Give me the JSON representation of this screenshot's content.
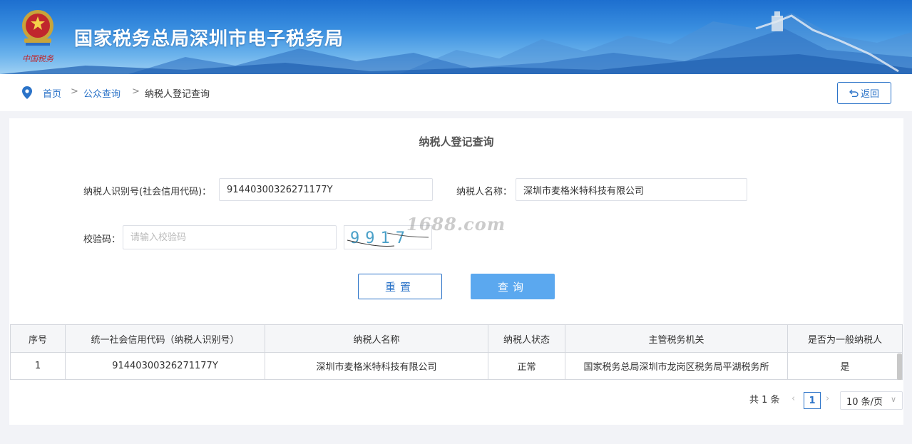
{
  "header": {
    "site_title": "国家税务总局深圳市电子税务局",
    "emblem_caption": "中国税务",
    "colors": {
      "sky_top": "#1d6fcf",
      "sky_bottom": "#9fd0f3",
      "accent": "#2b73c8",
      "primary_button": "#5ba8ef"
    }
  },
  "breadcrumb": {
    "icon": "location-pin-icon",
    "items": [
      "首页",
      "公众查询",
      "纳税人登记查询"
    ],
    "separator": ">",
    "back_label": "返回",
    "back_icon": "undo-icon"
  },
  "form": {
    "title": "纳税人登记查询",
    "taxpayer_id_label": "纳税人识别号(社会信用代码)：",
    "taxpayer_id_value": "91440300326271177Y",
    "taxpayer_name_label": "纳税人名称：",
    "taxpayer_name_value": "深圳市麦格米特科技有限公司",
    "captcha_label": "校验码：",
    "captcha_placeholder": "请输入校验码",
    "captcha_text": "9917",
    "watermark": "1688.com",
    "reset_label": "重置",
    "query_label": "查询"
  },
  "table": {
    "columns": [
      "序号",
      "统一社会信用代码（纳税人识别号）",
      "纳税人名称",
      "纳税人状态",
      "主管税务机关",
      "是否为一般纳税人"
    ],
    "rows": [
      [
        "1",
        "91440300326271177Y",
        "深圳市麦格米特科技有限公司",
        "正常",
        "国家税务总局深圳市龙岗区税务局平湖税务所",
        "是"
      ]
    ]
  },
  "pagination": {
    "total_text": "共 1 条",
    "current_page": "1",
    "page_size": "10 条/页"
  }
}
